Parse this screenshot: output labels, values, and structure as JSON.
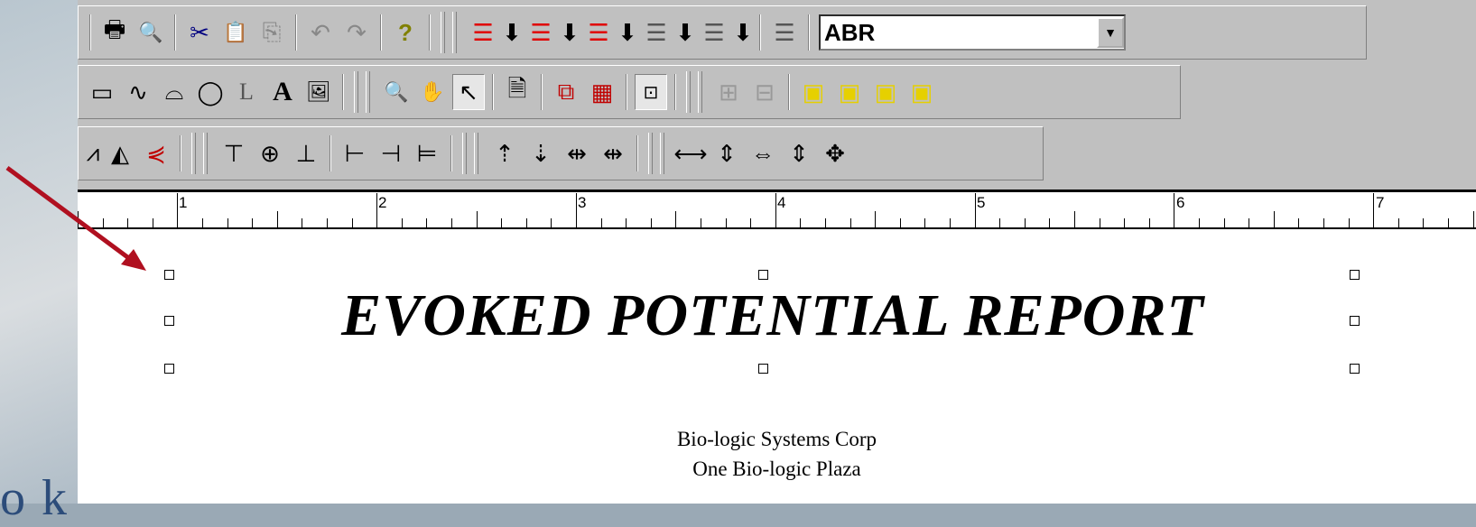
{
  "background": {
    "partial_text": "o k"
  },
  "toolbar1": {
    "buttons": [
      {
        "icon": "printer-icon",
        "glyph": "🖶"
      },
      {
        "icon": "print-preview-icon",
        "glyph": "🔍"
      },
      {
        "icon": "cut-icon",
        "glyph": "✂"
      },
      {
        "icon": "paste-icon",
        "glyph": "📋"
      },
      {
        "icon": "copy-icon",
        "glyph": "⎘"
      },
      {
        "icon": "undo-icon",
        "glyph": "↶"
      },
      {
        "icon": "redo-icon",
        "glyph": "↷"
      },
      {
        "icon": "help-icon",
        "glyph": "?"
      }
    ],
    "section_glyph": "☰",
    "down_glyph": "⬇",
    "report_section_selected": "ABR",
    "combo_arrow": "▼"
  },
  "toolbar2": {
    "draw_tools": [
      "▭",
      "∿",
      "⌓",
      "◯",
      "L",
      "A",
      "🖼"
    ],
    "view_tools": [
      "🔍",
      "✋",
      "↖"
    ],
    "other_tools": [
      "🗎",
      "⧉",
      "▦",
      "⊡",
      "⊞",
      "⊟",
      "▣",
      "▣",
      "▣",
      "▣"
    ]
  },
  "toolbar3": {
    "tools": [
      "⩘",
      "◭",
      "⋞",
      "⊤",
      "⊕",
      "⊥",
      "⊢",
      "⊣",
      "⊨",
      "⇡",
      "⇣",
      "⇹",
      "⇹",
      "⟷",
      "⇕",
      "⇔",
      "⇕",
      "✥"
    ]
  },
  "ruler": {
    "numbers": [
      "1",
      "2",
      "3",
      "4",
      "5",
      "6",
      "7"
    ]
  },
  "document": {
    "title": "EVOKED POTENTIAL REPORT",
    "address_line1": "Bio-logic Systems Corp",
    "address_line2": "One Bio-logic Plaza"
  },
  "colors": {
    "annotation_arrow": "#b01020",
    "selected_section_red": "#e00000"
  }
}
